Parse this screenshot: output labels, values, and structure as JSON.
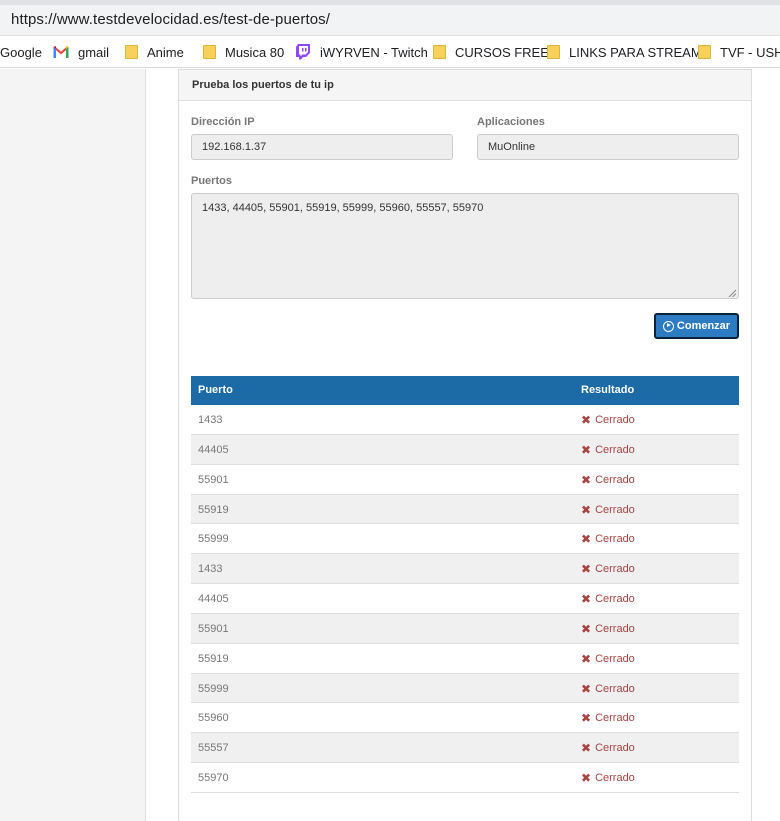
{
  "browser": {
    "url": "https://www.testdevelocidad.es/test-de-puertos/",
    "bookmarks": [
      {
        "label": "Google",
        "icon": "none"
      },
      {
        "label": "gmail",
        "icon": "gmail-icon"
      },
      {
        "label": "Anime",
        "icon": "folder-icon"
      },
      {
        "label": "Musica 80",
        "icon": "folder-icon"
      },
      {
        "label": "iWYRVEN - Twitch",
        "icon": "twitch-icon"
      },
      {
        "label": "CURSOS FREE",
        "icon": "folder-icon"
      },
      {
        "label": "LINKS PARA STREAM",
        "icon": "folder-icon"
      },
      {
        "label": "TVF - USH",
        "icon": "folder-icon"
      }
    ]
  },
  "panel": {
    "title": "Prueba los puertos de tu ip",
    "ip_label": "Dirección IP",
    "ip_value": "192.168.1.37",
    "apps_label": "Aplicaciones",
    "apps_value": "MuOnline",
    "ports_label": "Puertos",
    "ports_value": "1433, 44405, 55901, 55919, 55999, 55960, 55557, 55970",
    "start_button": "Comenzar"
  },
  "results": {
    "col_port": "Puerto",
    "col_result": "Resultado",
    "rows": [
      {
        "port": "1433",
        "status": "Cerrado"
      },
      {
        "port": "44405",
        "status": "Cerrado"
      },
      {
        "port": "55901",
        "status": "Cerrado"
      },
      {
        "port": "55919",
        "status": "Cerrado"
      },
      {
        "port": "55999",
        "status": "Cerrado"
      },
      {
        "port": "1433",
        "status": "Cerrado"
      },
      {
        "port": "44405",
        "status": "Cerrado"
      },
      {
        "port": "55901",
        "status": "Cerrado"
      },
      {
        "port": "55919",
        "status": "Cerrado"
      },
      {
        "port": "55999",
        "status": "Cerrado"
      },
      {
        "port": "55960",
        "status": "Cerrado"
      },
      {
        "port": "55557",
        "status": "Cerrado"
      },
      {
        "port": "55970",
        "status": "Cerrado"
      }
    ]
  },
  "colors": {
    "header_blue": "#1c6aa6",
    "button_blue": "#2c7bc3",
    "closed_red": "#a94442"
  }
}
